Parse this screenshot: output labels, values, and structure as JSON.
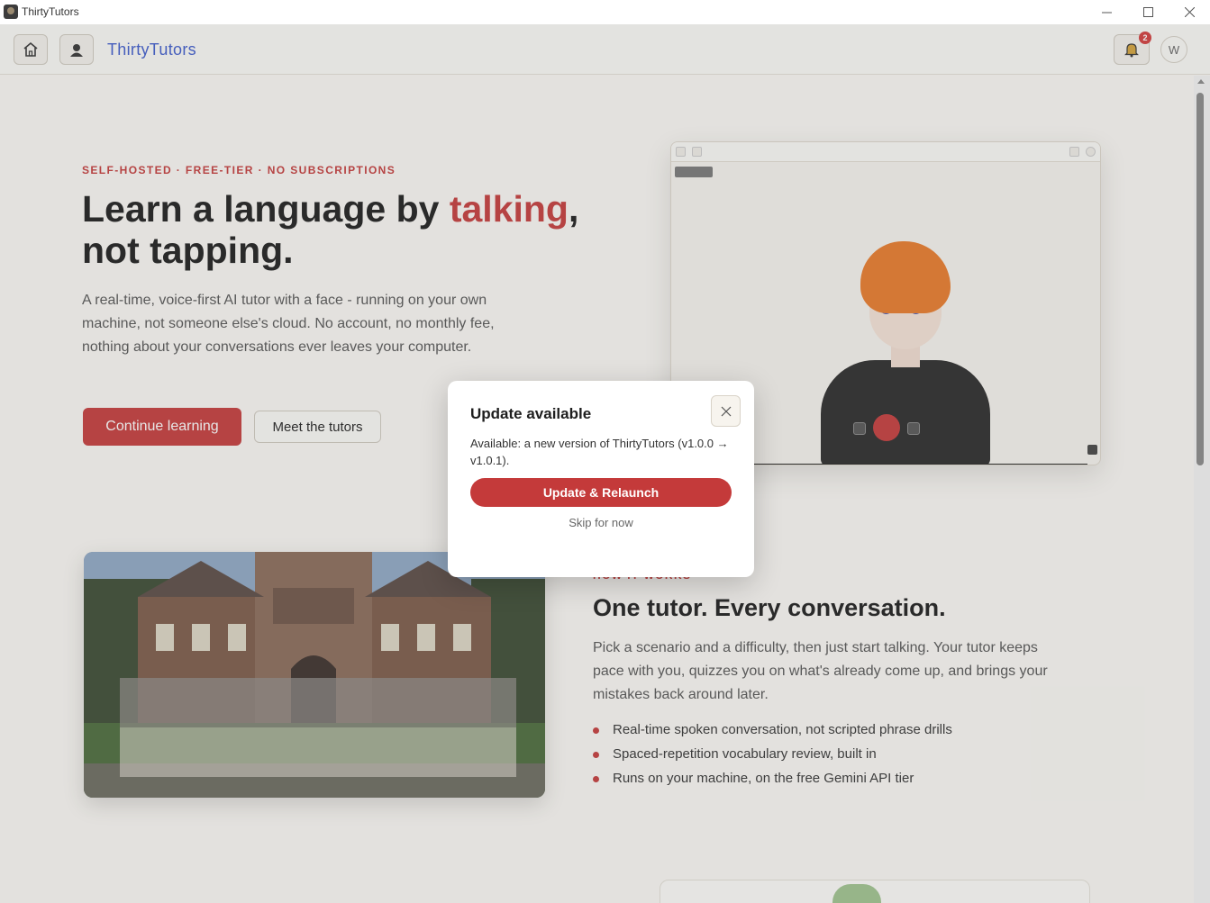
{
  "window": {
    "title": "ThirtyTutors",
    "controls": [
      "minimize-icon",
      "maximize-icon",
      "close-icon"
    ]
  },
  "appbar": {
    "brand": "ThirtyTutors",
    "notification_count": "2",
    "avatar_initial": "W",
    "icons": [
      "home-icon",
      "tutors-icon",
      "bell-icon"
    ]
  },
  "hero": {
    "eyebrow": "SELF-HOSTED · FREE-TIER · NO SUBSCRIPTIONS",
    "headline_part1": "Learn a language by ",
    "headline_accent": "talking",
    "headline_part2": ",",
    "headline_line2": "not tapping.",
    "lead": "A real-time, voice-first AI tutor with a face - running on your own machine, not someone else's cloud. No account, no monthly fee, nothing about your conversations ever leaves your computer.",
    "primary_button": "Continue learning",
    "secondary_button": "Meet the tutors"
  },
  "how_it_works": {
    "label": "HOW IT WORKS",
    "title": "One tutor. Every conversation.",
    "body": "Pick a scenario and a difficulty, then just start talking. Your tutor keeps pace with you, quizzes you on what's already come up, and brings your mistakes back around later.",
    "bullets": [
      "Real-time spoken conversation, not scripted phrase drills",
      "Spaced-repetition vocabulary review, built in",
      "Runs on your machine, on the free Gemini API tier"
    ]
  },
  "modal": {
    "title": "Update available",
    "message": "Available: a new version of ThirtyTutors (v1.0.0 → v1.0.1).",
    "primary_button": "Update & Relaunch",
    "secondary_link": "Skip for now"
  },
  "colors": {
    "accent": "#c43a3a",
    "brand": "#3d5bcc",
    "background": "#faf8f4"
  }
}
